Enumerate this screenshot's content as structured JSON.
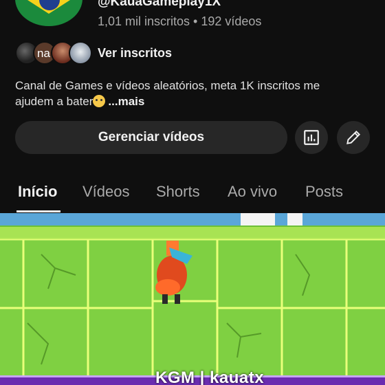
{
  "channel": {
    "handle": "@KauaGameplay1X",
    "stats": "1,01 mil inscritos • 192 vídeos"
  },
  "subscribers": {
    "avatar_2_text": "na",
    "link_label": "Ver inscritos"
  },
  "description": {
    "text": "Canal de Games e vídeos aleatórios, meta 1K inscritos me ajudem a bater",
    "more_label": "...mais"
  },
  "actions": {
    "manage_label": "Gerenciar vídeos",
    "stats_icon": "analytics-icon",
    "edit_icon": "pencil-icon"
  },
  "tabs": [
    {
      "label": "Início",
      "active": true
    },
    {
      "label": "Vídeos",
      "active": false
    },
    {
      "label": "Shorts",
      "active": false
    },
    {
      "label": "Ao vivo",
      "active": false
    },
    {
      "label": "Posts",
      "active": false
    }
  ],
  "featured_video": {
    "watermark": "KGM | kauatx"
  }
}
